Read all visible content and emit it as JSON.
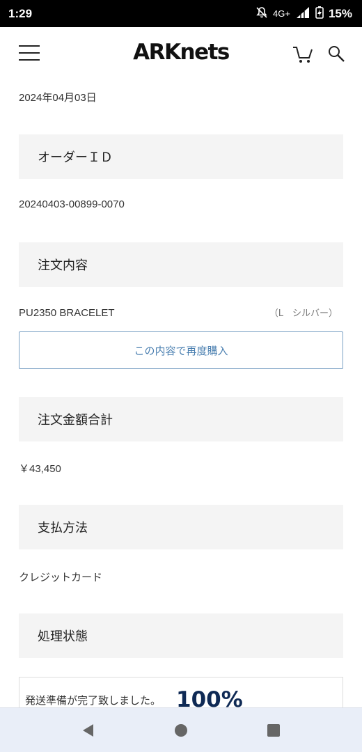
{
  "status_bar": {
    "time": "1:29",
    "network": "4G+",
    "battery": "15%"
  },
  "header": {
    "logo": "ARKnets",
    "icons": [
      "menu-icon",
      "cart-icon",
      "search-icon"
    ]
  },
  "order": {
    "date": "2024年04月03日",
    "order_id_heading": "オーダーＩＤ",
    "order_id": "20240403-00899-0070",
    "contents_heading": "注文内容",
    "product_name": "PU2350 BRACELET",
    "product_variant": "（L　シルバー）",
    "rebuy_label": "この内容で再度購入",
    "total_heading": "注文金額合計",
    "total": "￥43,450",
    "payment_heading": "支払方法",
    "payment_method": "クレジットカード",
    "status_heading": "処理状態",
    "status_text": "発送準備が完了致しました。",
    "status_percent": "100%"
  },
  "colors": {
    "accent_blue": "#4a7fb0",
    "status_navy": "#0f2a55",
    "section_bg": "#f4f4f4"
  }
}
